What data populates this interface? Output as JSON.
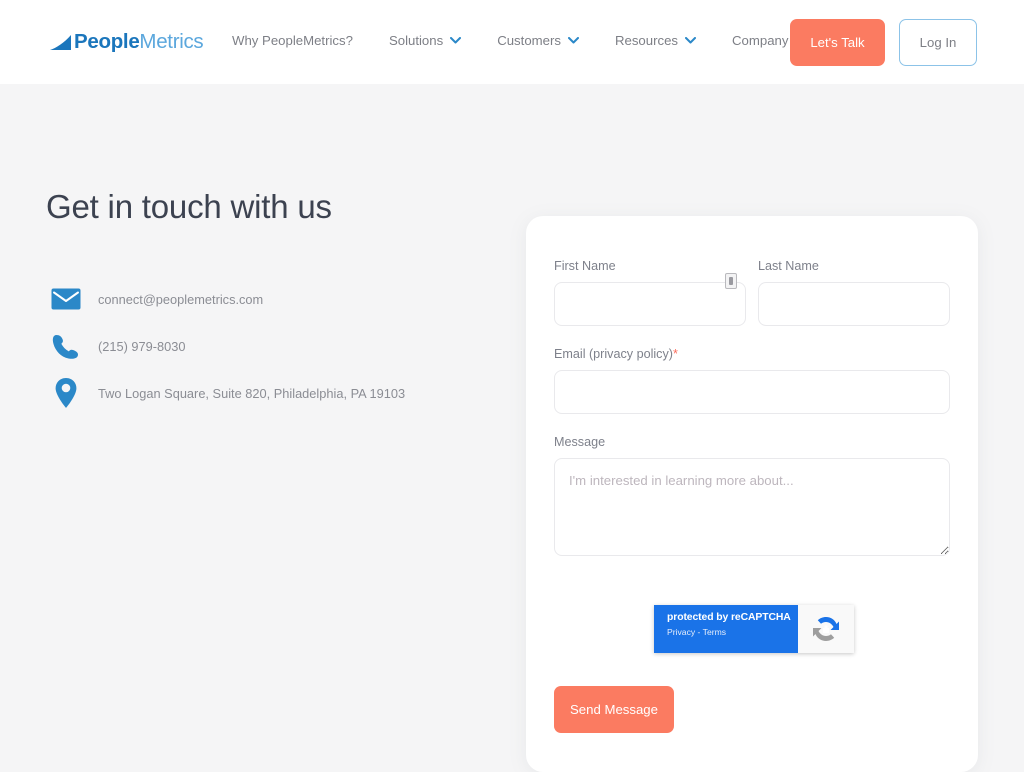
{
  "header": {
    "logo": {
      "bold_part": "People",
      "light_part": "Metrics",
      "mark": "swoosh-icon"
    },
    "nav": [
      {
        "label": "Why PeopleMetrics?",
        "has_caret": false
      },
      {
        "label": "Solutions",
        "has_caret": true
      },
      {
        "label": "Customers",
        "has_caret": true
      },
      {
        "label": "Resources",
        "has_caret": true
      },
      {
        "label": "Company",
        "has_caret": true
      }
    ],
    "cta_label": "Let's Talk",
    "login_label": "Log In"
  },
  "left": {
    "headline": "Get in touch with us",
    "contacts": [
      {
        "icon": "envelope-icon",
        "text": "connect@peoplemetrics.com"
      },
      {
        "icon": "phone-icon",
        "text": "(215) 979-8030"
      },
      {
        "icon": "location-pin-icon",
        "text": "Two Logan Square, Suite 820, Philadelphia, PA 19103"
      }
    ]
  },
  "form": {
    "first_name": {
      "label": "First Name",
      "value": "",
      "placeholder": ""
    },
    "last_name": {
      "label": "Last Name",
      "value": "",
      "placeholder": ""
    },
    "email": {
      "label": "Email (privacy policy)",
      "required_mark": "*",
      "value": "",
      "placeholder": ""
    },
    "message": {
      "label": "Message",
      "value": "",
      "placeholder": "I'm interested in learning more about..."
    },
    "submit_label": "Send Message"
  },
  "recaptcha": {
    "title": "protected by reCAPTCHA",
    "subtitle": "Privacy - Terms",
    "icon": "recaptcha-icon"
  },
  "colors": {
    "accent_coral": "#fb7b61",
    "brand_blue": "#1b76bc",
    "brand_blue_light": "#5ba7dd",
    "icon_blue": "#2b88c8",
    "page_bg": "#f5f5f6",
    "required_red": "#fb6a5a",
    "recaptcha_blue": "#1a73e8"
  }
}
